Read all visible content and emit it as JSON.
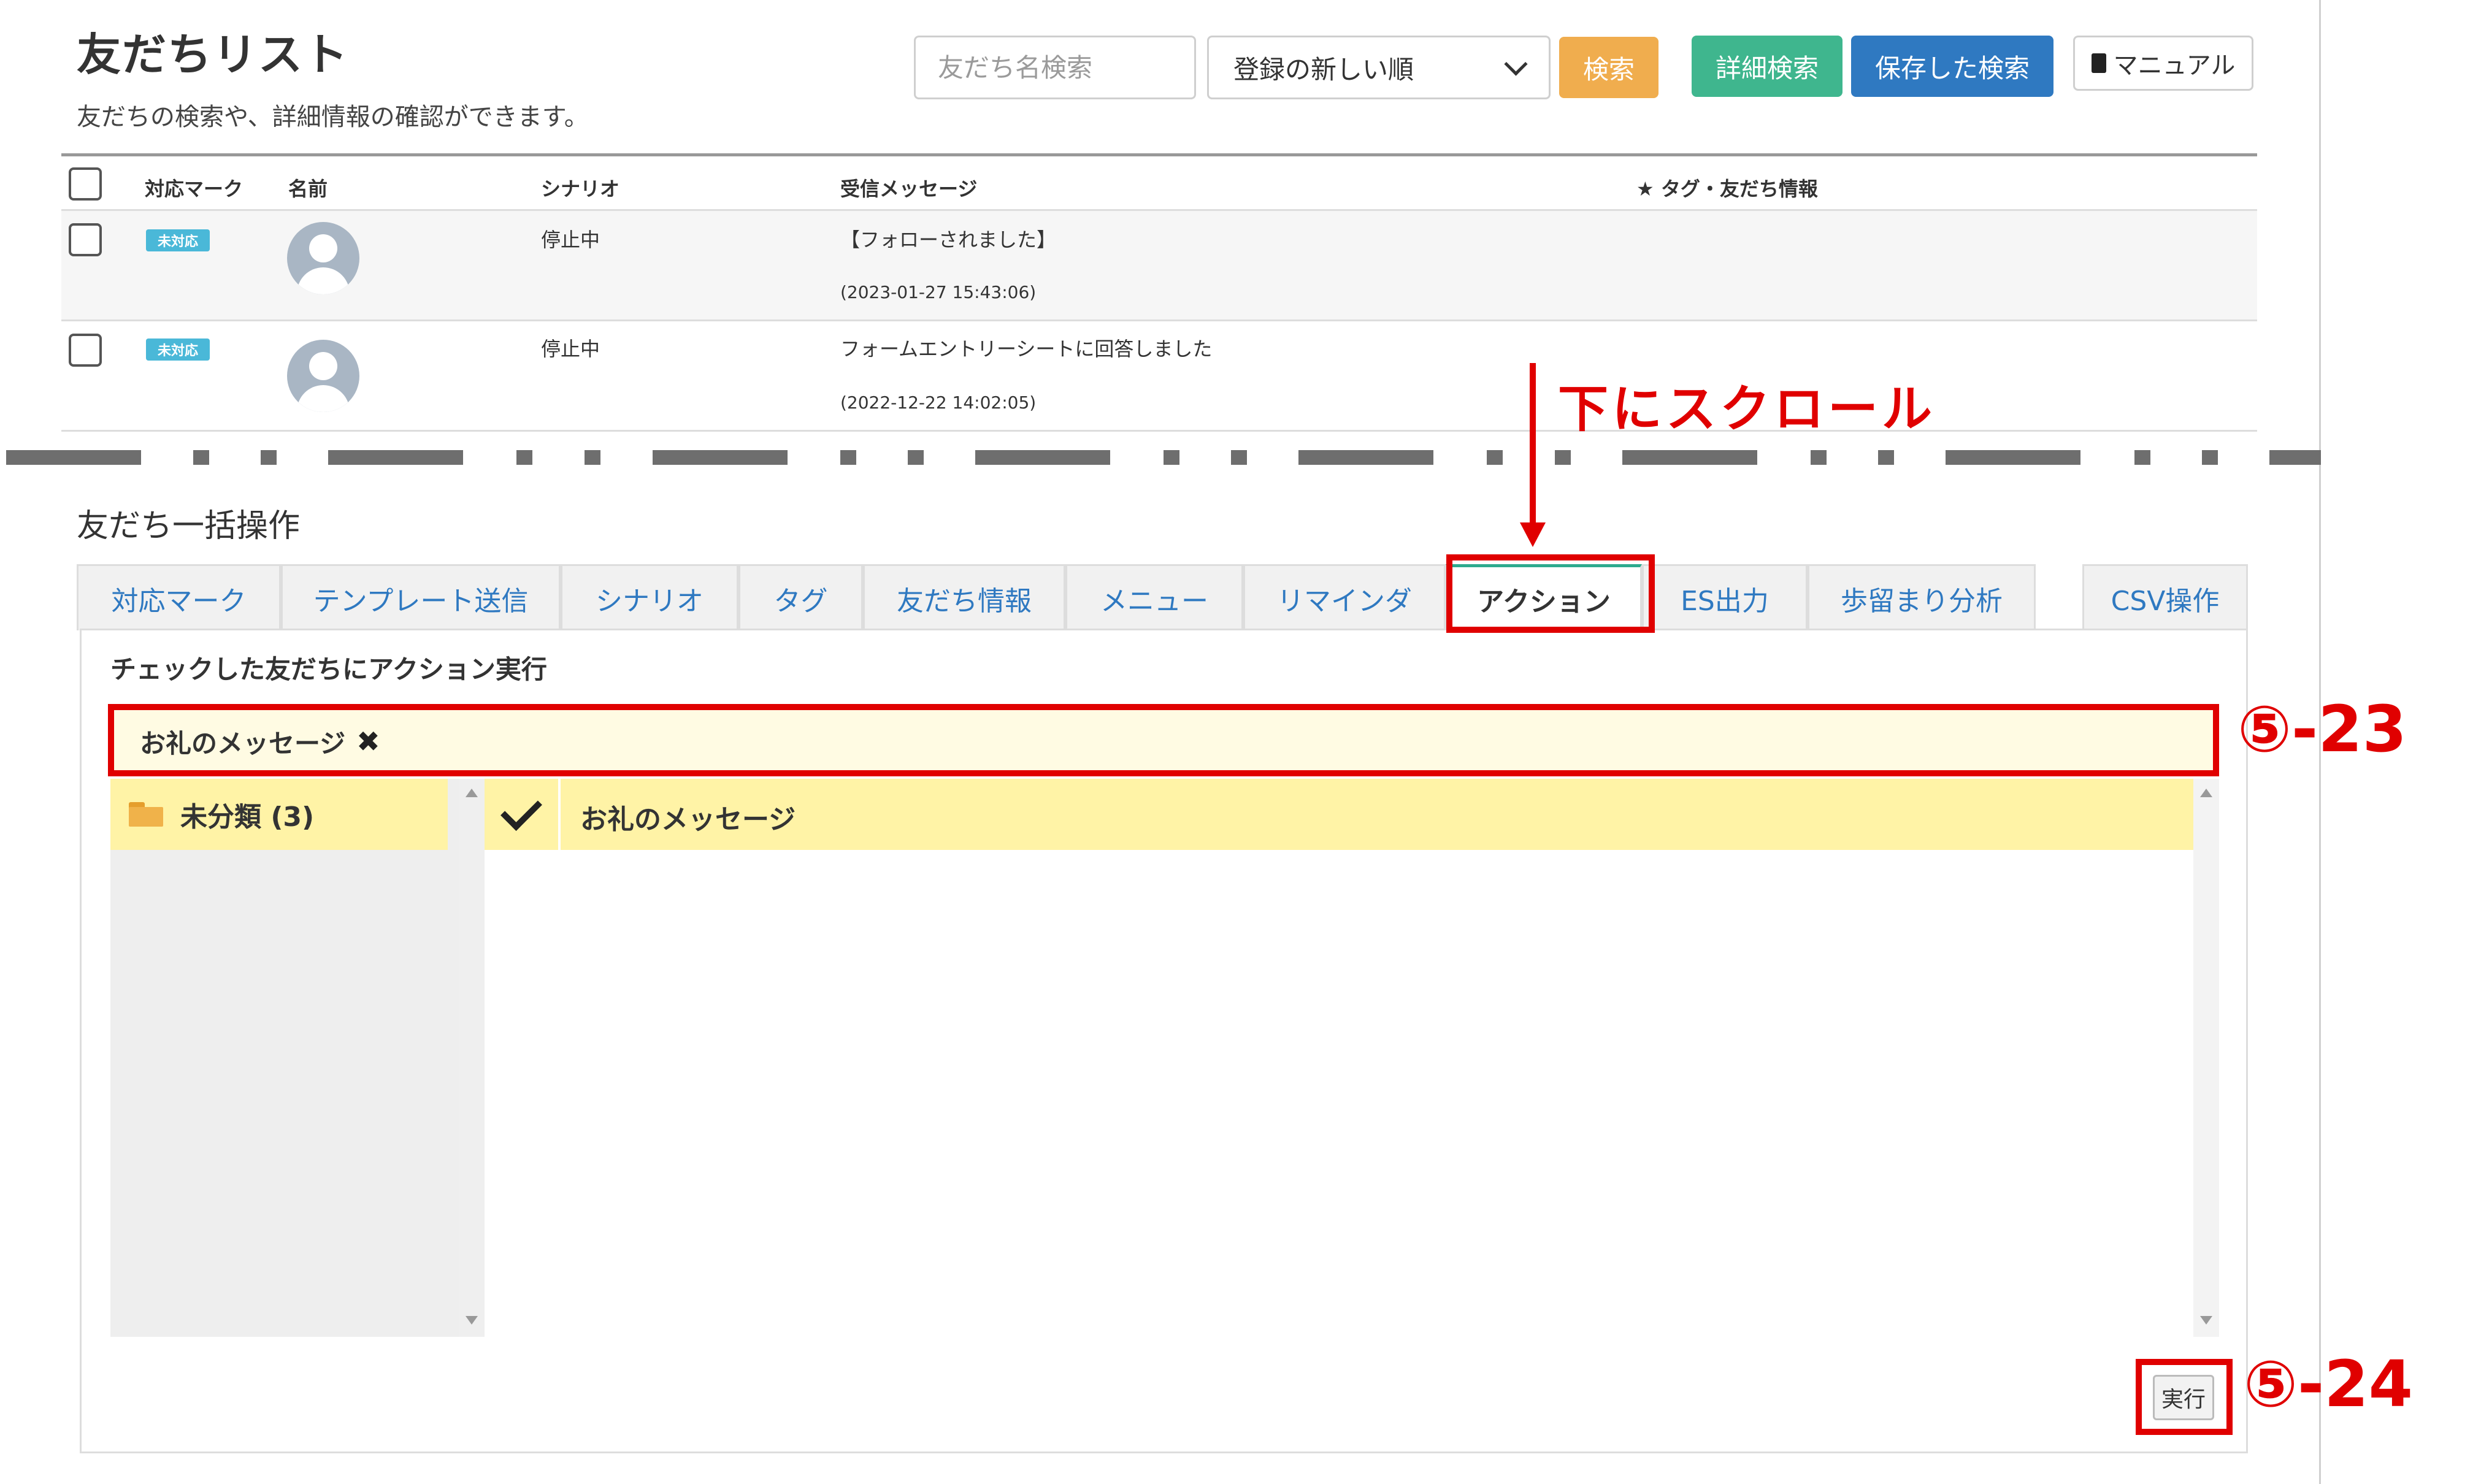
{
  "header": {
    "title": "友だちリスト",
    "subtitle": "友だちの検索や、詳細情報の確認ができます。"
  },
  "toolbar": {
    "search_placeholder": "友だち名検索",
    "sort_selected": "登録の新しい順",
    "search_label": "検索",
    "detail_search_label": "詳細検索",
    "saved_search_label": "保存した検索",
    "manual_label": "マニュアル"
  },
  "colors": {
    "search_button": "#f0ad4e",
    "detail_button": "#3fb68e",
    "saved_button": "#2f79c1",
    "annotation_red": "#e00000",
    "highlight_yellow": "#fff3a6"
  },
  "table": {
    "headers": [
      "対応マーク",
      "名前",
      "シナリオ",
      "受信メッセージ",
      "★ タグ・友だち情報"
    ],
    "rows": [
      {
        "mark": "未対応",
        "scenario": "停止中",
        "message": "【フォローされました】",
        "time": "(2023-01-27 15:43:06)"
      },
      {
        "mark": "未対応",
        "scenario": "停止中",
        "message": "フォームエントリーシートに回答しました",
        "time": "(2022-12-22 14:02:05)"
      }
    ]
  },
  "annotation": {
    "scroll_text": "下にスクロール",
    "label_23": "⑤-23",
    "label_24": "⑤-24"
  },
  "bulk": {
    "title": "友だち一括操作",
    "tabs": [
      "対応マーク",
      "テンプレート送信",
      "シナリオ",
      "タグ",
      "友だち情報",
      "メニュー",
      "リマインダ",
      "アクション",
      "ES出力",
      "歩留まり分析",
      "CSV操作"
    ],
    "active_tab": "アクション",
    "content_heading": "チェックした友だちにアクション実行",
    "selected_action": "お礼のメッセージ",
    "category": "未分類 (3)",
    "template": "お礼のメッセージ",
    "execute_label": "実行"
  }
}
